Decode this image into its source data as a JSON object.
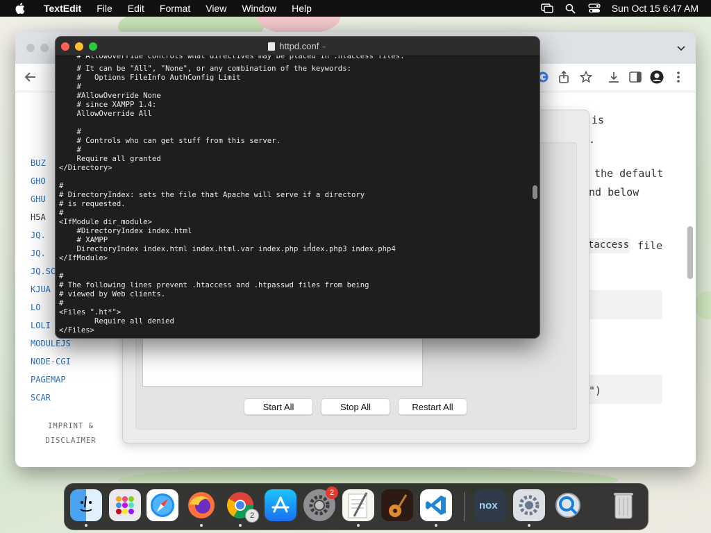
{
  "menubar": {
    "app_name": "TextEdit",
    "items": [
      "File",
      "Edit",
      "Format",
      "View",
      "Window",
      "Help"
    ],
    "clock": "Sun Oct 15  6:47 AM"
  },
  "browser": {
    "sidebar_links": [
      "BUZ",
      "GHO",
      "GHU",
      "H5A",
      "JQ.",
      "JQ.",
      "JQ.SC",
      "KJUA",
      "LO",
      "LOLI",
      "MODULEJS",
      "NODE-CGI",
      "PAGEMAP",
      "SCAR"
    ],
    "imprint": "IMPRINT & DISCLAIMER",
    "article": {
      "line1": "is",
      "line2": ".",
      "line3": "the default",
      "line4": "nd below",
      "line5_code": "taccess",
      "line5_text": "file",
      "line6": "\")"
    }
  },
  "xampp": {
    "buttons": [
      "Start All",
      "Stop All",
      "Restart All"
    ]
  },
  "editor": {
    "title": "httpd.conf",
    "first_line": "    # AllowOverride controls what directives may be placed in .htaccess files.",
    "lines": [
      "    # It can be \"All\", \"None\", or any combination of the keywords:",
      "    #   Options FileInfo AuthConfig Limit",
      "    #",
      "    #AllowOverride None",
      "    # since XAMPP 1.4:",
      "    AllowOverride All",
      "",
      "    #",
      "    # Controls who can get stuff from this server.",
      "    #",
      "    Require all granted",
      "</Directory>",
      "",
      "#",
      "# DirectoryIndex: sets the file that Apache will serve if a directory",
      "# is requested.",
      "#",
      "<IfModule dir_module>",
      "    #DirectoryIndex index.html",
      "    # XAMPP",
      "    DirectoryIndex index.html index.html.var index.php index.php3 index.php4",
      "</IfModule>",
      "",
      "#",
      "# The following lines prevent .htaccess and .htpasswd files from being",
      "# viewed by Web clients.",
      "#",
      "<Files \".ht*\">",
      "        Require all denied",
      "</Files>"
    ]
  },
  "dock": {
    "apps": [
      "finder-icon",
      "launchpad-icon",
      "safari-icon",
      "firefox-icon",
      "chrome-icon",
      "app-store-icon",
      "system-settings-icon",
      "textedit-icon",
      "garageband-icon",
      "vscode-icon",
      "nox-icon",
      "gear-app-icon",
      "quicktime-icon",
      "trash-icon"
    ],
    "settings_badge": "2",
    "chrome_badge": "2"
  },
  "colors": {
    "terminal_bg": "#1e1e1e",
    "link_blue": "#2a6ab3",
    "close": "#ff5f57",
    "minimize": "#febc2e",
    "zoom": "#28c840"
  }
}
